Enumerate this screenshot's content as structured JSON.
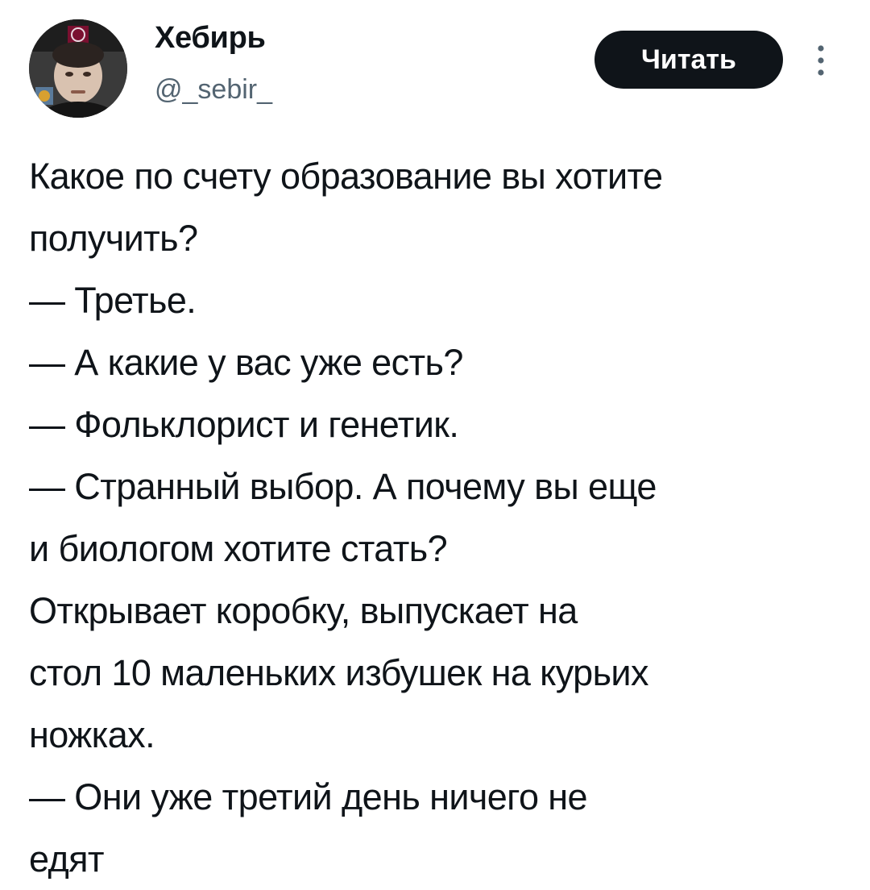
{
  "author": {
    "display_name": "Хебирь",
    "handle": "@_sebir_",
    "avatar_icon": "user-avatar-photo"
  },
  "actions": {
    "follow_label": "Читать",
    "more_icon": "vertical-ellipsis-icon"
  },
  "tweet": {
    "lines": [
      "Какое по счету образование вы хотите",
      "получить?",
      "— Третье.",
      "— А какие у вас уже есть?",
      "— Фольклорист и генетик.",
      "— Странный выбор. А почему вы еще",
      "и биологом хотите стать?",
      "Открывает коробку, выпускает на",
      "стол 10 маленьких избушек на курьих",
      "ножках.",
      "— Они уже третий день ничего не",
      "едят"
    ]
  },
  "colors": {
    "text_primary": "#0f1419",
    "text_secondary": "#536471",
    "button_bg": "#0f1419",
    "button_text": "#ffffff",
    "background": "#ffffff"
  }
}
